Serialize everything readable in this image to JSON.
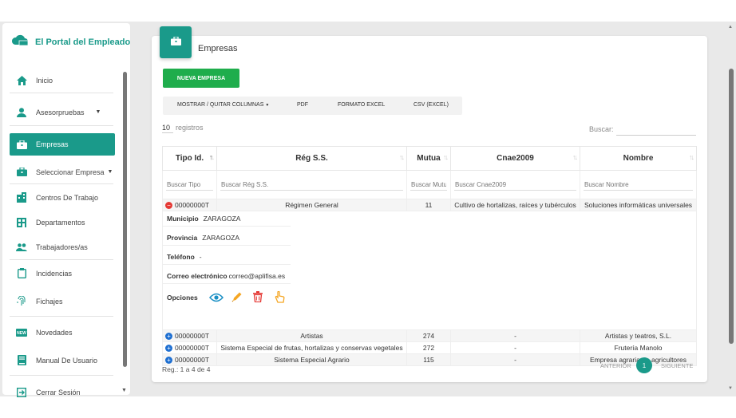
{
  "app": {
    "title": "El Portal del Empleado"
  },
  "sidebar": {
    "items": [
      {
        "label": "Inicio",
        "icon": "home-icon"
      },
      {
        "label": "Asesorpruebas",
        "icon": "user-icon"
      },
      {
        "label": "Empresas",
        "icon": "briefcase-icon",
        "active": true
      },
      {
        "label": "Seleccionar Empresa",
        "icon": "briefcase-icon"
      },
      {
        "label": "Centros De Trabajo",
        "icon": "building-icon"
      },
      {
        "label": "Departamentos",
        "icon": "grid-building-icon"
      },
      {
        "label": "Trabajadores/as",
        "icon": "people-icon"
      },
      {
        "label": "Incidencias",
        "icon": "clipboard-icon"
      },
      {
        "label": "Fichajes",
        "icon": "fingerprint-icon"
      },
      {
        "label": "Novedades",
        "icon": "new-badge-icon"
      },
      {
        "label": "Manual De Usuario",
        "icon": "book-icon"
      },
      {
        "label": "Cerrar Sesión",
        "icon": "exit-icon"
      }
    ]
  },
  "page": {
    "title": "Empresas",
    "new_button": "NUEVA EMPRESA",
    "export": {
      "columns": "MOSTRAR / QUITAR COLUMNAS",
      "pdf": "PDF",
      "excel": "FORMATO EXCEL",
      "csv": "CSV (EXCEL)"
    },
    "length": {
      "value": "10",
      "label": "registros"
    },
    "search": {
      "label": "Buscar:"
    }
  },
  "table": {
    "headers": [
      "Tipo Id.",
      "Rég S.S.",
      "Mutua",
      "Cnae2009",
      "Nombre"
    ],
    "filters": [
      "Buscar Tipo",
      "Buscar Rég S.S.",
      "Buscar Mutua",
      "Buscar Cnae2009",
      "Buscar Nombre"
    ],
    "rows": [
      {
        "id": "00000000T",
        "reg": "Régimen General",
        "mutua": "11",
        "cnae": "Cultivo de hortalizas, raíces y tubérculos",
        "nombre": "Soluciones informáticas universales"
      },
      {
        "id": "00000000T",
        "reg": "Artistas",
        "mutua": "274",
        "cnae": "-",
        "nombre": "Artistas y teatros, S.L."
      },
      {
        "id": "00000000T",
        "reg": "Sistema Especial de frutas, hortalizas y conservas vegetales",
        "mutua": "272",
        "cnae": "-",
        "nombre": "Frutería Manolo"
      },
      {
        "id": "00000000T",
        "reg": "Sistema Especial Agrario",
        "mutua": "115",
        "cnae": "-",
        "nombre": "Empresa agraria de agricultores"
      }
    ],
    "detail": {
      "municipio": {
        "label": "Municipio",
        "value": "ZARAGOZA"
      },
      "provincia": {
        "label": "Provincia",
        "value": "ZARAGOZA"
      },
      "telefono": {
        "label": "Teléfono",
        "value": "-"
      },
      "correo": {
        "label": "Correo electrónico",
        "value": "correo@aplifisa.es"
      },
      "opciones": {
        "label": "Opciones",
        "icons": [
          "eye-icon",
          "pencil-icon",
          "trash-icon",
          "pointer-icon"
        ]
      }
    }
  },
  "footer": {
    "info": "Reg.: 1 a 4 de 4",
    "prev": "ANTERIOR",
    "page": "1",
    "next": "SIGUIENTE"
  },
  "colors": {
    "accent": "#1a9a8a",
    "primary_button": "#1fad4c",
    "danger": "#e53935",
    "info": "#1e6fd1",
    "edit": "#f5a623"
  }
}
